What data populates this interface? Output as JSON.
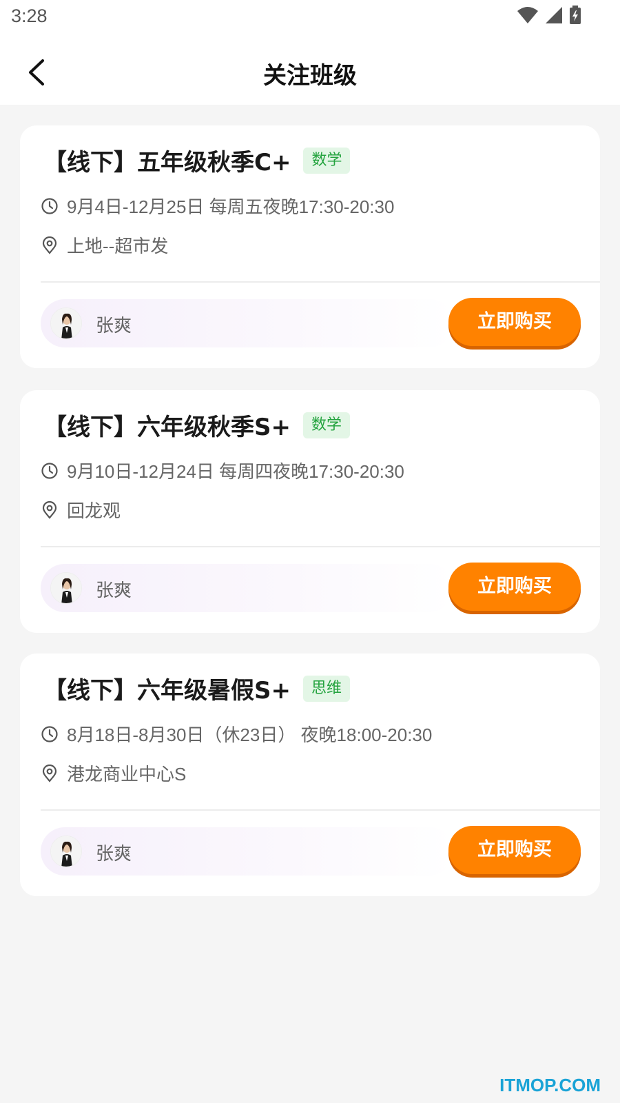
{
  "status_bar": {
    "time": "3:28"
  },
  "header": {
    "title": "关注班级"
  },
  "classes": [
    {
      "title": "【线下】五年级秋季C+",
      "subject": "数学",
      "schedule": "9月4日-12月25日 每周五夜晚17:30-20:30",
      "location": "上地--超市发",
      "teacher": "张爽",
      "button_label": "立即购买"
    },
    {
      "title": "【线下】六年级秋季S+",
      "subject": "数学",
      "schedule": "9月10日-12月24日 每周四夜晚17:30-20:30",
      "location": "回龙观",
      "teacher": "张爽",
      "button_label": "立即购买"
    },
    {
      "title": "【线下】六年级暑假S+",
      "subject": "思维",
      "schedule": "8月18日-8月30日（休23日） 夜晚18:00-20:30",
      "location": "港龙商业中心S",
      "teacher": "张爽",
      "button_label": "立即购买"
    }
  ],
  "watermark": "ITMOP.COM",
  "colors": {
    "accent": "#ff8200",
    "tag_bg": "#e3f6e6",
    "tag_text": "#23a33e",
    "background": "#f5f5f5"
  }
}
